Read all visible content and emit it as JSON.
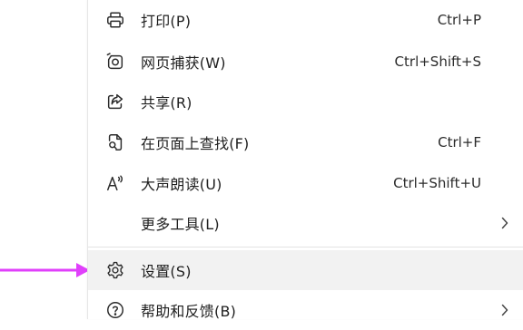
{
  "menu": {
    "items": [
      {
        "label": "打印(P)",
        "shortcut": "Ctrl+P",
        "icon": "print-icon"
      },
      {
        "label": "网页捕获(W)",
        "shortcut": "Ctrl+Shift+S",
        "icon": "web-capture-icon"
      },
      {
        "label": "共享(R)",
        "shortcut": "",
        "icon": "share-icon"
      },
      {
        "label": "在页面上查找(F)",
        "shortcut": "Ctrl+F",
        "icon": "find-on-page-icon"
      },
      {
        "label": "大声朗读(U)",
        "shortcut": "Ctrl+Shift+U",
        "icon": "read-aloud-icon"
      },
      {
        "label": "更多工具(L)",
        "shortcut": "",
        "icon": ""
      },
      {
        "label": "设置(S)",
        "shortcut": "",
        "icon": "gear-icon"
      },
      {
        "label": "帮助和反馈(B)",
        "shortcut": "",
        "icon": "help-icon"
      }
    ]
  },
  "annotation": {
    "arrow_color": "#e040fb"
  }
}
